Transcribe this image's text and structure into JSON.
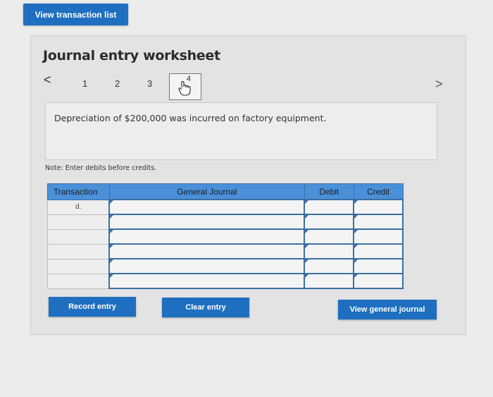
{
  "top_button": "View transaction list",
  "title": "Journal entry worksheet",
  "pagination": {
    "prev": "<",
    "next": ">",
    "pages": [
      "1",
      "2",
      "3",
      "4"
    ]
  },
  "description": "Depreciation of $200,000 was incurred on factory equipment.",
  "note": "Note: Enter debits before credits.",
  "table": {
    "headers": {
      "transaction": "Transaction",
      "journal": "General Journal",
      "debit": "Debit",
      "credit": "Credit"
    },
    "rows": [
      {
        "transaction": "d."
      },
      {
        "transaction": ""
      },
      {
        "transaction": ""
      },
      {
        "transaction": ""
      },
      {
        "transaction": ""
      },
      {
        "transaction": ""
      }
    ]
  },
  "buttons": {
    "record": "Record entry",
    "clear": "Clear entry",
    "view_journal": "View general journal"
  }
}
